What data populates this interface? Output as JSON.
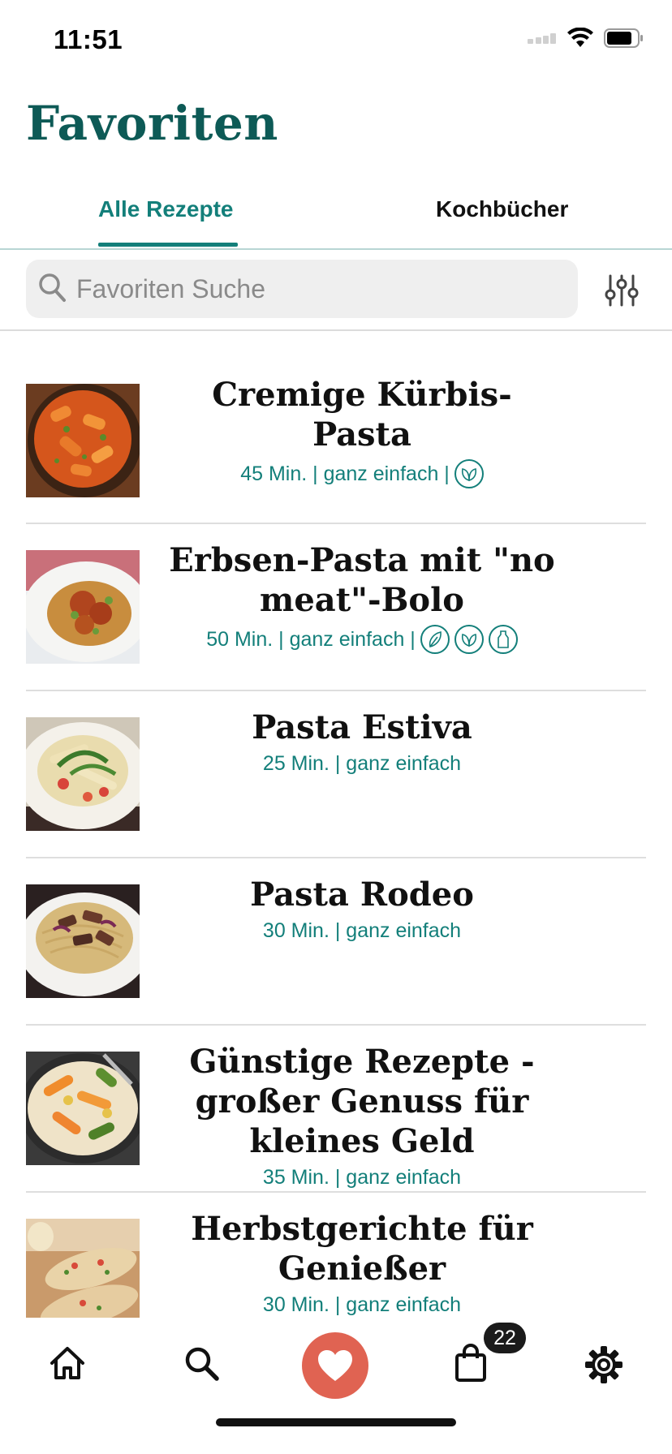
{
  "status_bar": {
    "time": "11:51"
  },
  "header": {
    "title": "Favoriten"
  },
  "tabs": [
    {
      "label": "Alle Rezepte",
      "active": true
    },
    {
      "label": "Kochbücher",
      "active": false
    }
  ],
  "search": {
    "placeholder": "Favoriten Suche",
    "value": ""
  },
  "recipes": [
    {
      "title": "Cremige Kürbis-Pasta",
      "meta": "45 Min. | ganz einfach |",
      "badges": [
        "vegetarian-icon"
      ]
    },
    {
      "title": "Erbsen-Pasta mit \"no meat\"-Bolo",
      "meta": "50 Min. | ganz einfach |",
      "badges": [
        "vegan-icon",
        "vegetarian-icon",
        "lactose-free-icon"
      ]
    },
    {
      "title": "Pasta Estiva",
      "meta": "25 Min. | ganz einfach",
      "badges": []
    },
    {
      "title": "Pasta Rodeo",
      "meta": "30 Min. | ganz einfach",
      "badges": []
    },
    {
      "title": "Günstige Rezepte - großer Genuss für kleines Geld",
      "meta": "35 Min. | ganz einfach",
      "badges": []
    },
    {
      "title": "Herbstgerichte für Genießer",
      "meta": "30 Min. | ganz einfach",
      "badges": []
    }
  ],
  "bottom_nav": {
    "items": [
      "home-icon",
      "search-icon",
      "heart-icon",
      "shopping-bag-icon",
      "settings-icon"
    ],
    "active": "heart-icon",
    "cart_count": "22"
  },
  "colors": {
    "accent": "#137f7a",
    "title": "#0d5a56",
    "favorite": "#e06352"
  }
}
